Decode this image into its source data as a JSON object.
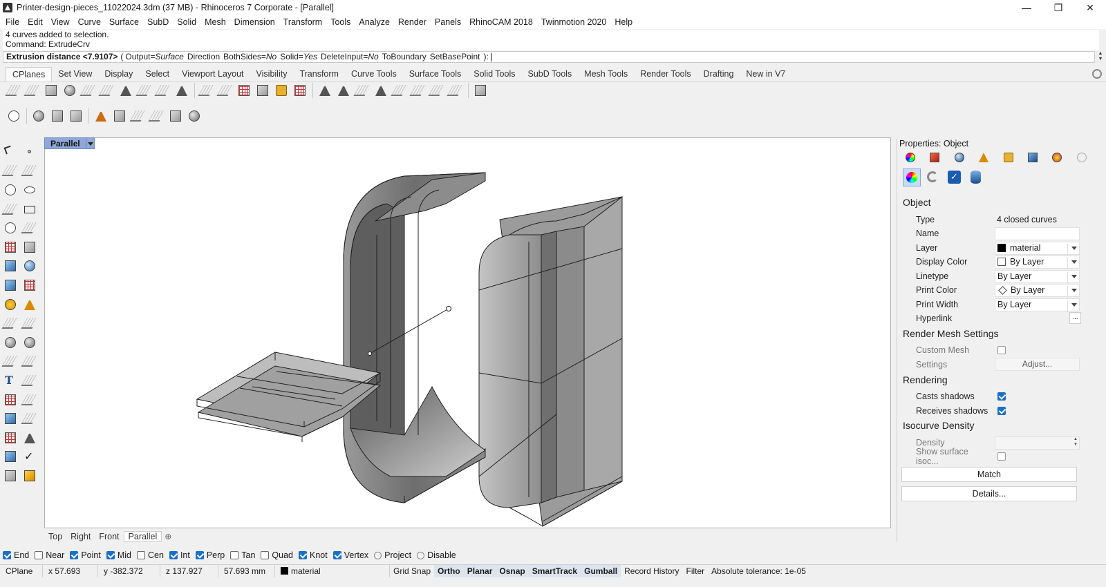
{
  "window": {
    "title": "Printer-design-pieces_11022024.3dm (37 MB) - Rhinoceros 7 Corporate - [Parallel]",
    "minimize": "—",
    "maximize": "❐",
    "close": "✕"
  },
  "menu": [
    "File",
    "Edit",
    "View",
    "Curve",
    "Surface",
    "SubD",
    "Solid",
    "Mesh",
    "Dimension",
    "Transform",
    "Tools",
    "Analyze",
    "Render",
    "Panels",
    "RhinoCAM 2018",
    "Twinmotion 2020",
    "Help"
  ],
  "command": {
    "history": [
      "4 curves added to selection.",
      "Command: ExtrudeCrv"
    ],
    "prompt": "Extrusion distance <7.9107>",
    "open_paren": "(",
    "options": [
      {
        "name": "Output=",
        "value": "Surface"
      },
      {
        "name": "Direction",
        "value": ""
      },
      {
        "name": "BothSides=",
        "value": "No"
      },
      {
        "name": "Solid=",
        "value": "Yes"
      },
      {
        "name": "DeleteInput=",
        "value": "No"
      },
      {
        "name": "ToBoundary",
        "value": ""
      },
      {
        "name": "SetBasePoint",
        "value": ""
      }
    ],
    "close_paren": "):"
  },
  "toolbar_tabs": [
    "CPlanes",
    "Set View",
    "Display",
    "Select",
    "Viewport Layout",
    "Visibility",
    "Transform",
    "Curve Tools",
    "Surface Tools",
    "Solid Tools",
    "SubD Tools",
    "Mesh Tools",
    "Render Tools",
    "Drafting",
    "New in V7"
  ],
  "active_toolbar_tab": "CPlanes",
  "viewport": {
    "title": "Parallel",
    "tabs": [
      "Top",
      "Right",
      "Front",
      "Parallel"
    ],
    "active_tab": "Parallel",
    "add_tab": "⊕"
  },
  "osnaps": [
    {
      "label": "End",
      "checked": true
    },
    {
      "label": "Near",
      "checked": false
    },
    {
      "label": "Point",
      "checked": true
    },
    {
      "label": "Mid",
      "checked": true
    },
    {
      "label": "Cen",
      "checked": false
    },
    {
      "label": "Int",
      "checked": true
    },
    {
      "label": "Perp",
      "checked": true
    },
    {
      "label": "Tan",
      "checked": false
    },
    {
      "label": "Quad",
      "checked": false
    },
    {
      "label": "Knot",
      "checked": true
    },
    {
      "label": "Vertex",
      "checked": true
    }
  ],
  "osnap_project": "Project",
  "osnap_disable": "Disable",
  "status": {
    "cplane": "CPlane",
    "x": "x 57.693",
    "y": "y -382.372",
    "z": "z 137.927",
    "distance": "57.693 mm",
    "layer": "material",
    "toggles": [
      {
        "label": "Grid Snap",
        "on": false
      },
      {
        "label": "Ortho",
        "on": true
      },
      {
        "label": "Planar",
        "on": true
      },
      {
        "label": "Osnap",
        "on": true
      },
      {
        "label": "SmartTrack",
        "on": true
      },
      {
        "label": "Gumball",
        "on": true
      },
      {
        "label": "Record History",
        "on": false
      },
      {
        "label": "Filter",
        "on": false
      }
    ],
    "tolerance": "Absolute tolerance: 1e-05"
  },
  "properties": {
    "title": "Properties: Object",
    "sections": {
      "object": "Object",
      "render_mesh": "Render Mesh Settings",
      "rendering": "Rendering",
      "isocurve": "Isocurve Density"
    },
    "type_label": "Type",
    "type_value": "4 closed curves",
    "name_label": "Name",
    "name_value": "",
    "layer_label": "Layer",
    "layer_value": "material",
    "display_color_label": "Display Color",
    "display_color_value": "By Layer",
    "linetype_label": "Linetype",
    "linetype_value": "By Layer",
    "print_color_label": "Print Color",
    "print_color_value": "By Layer",
    "print_width_label": "Print Width",
    "print_width_value": "By Layer",
    "hyperlink_label": "Hyperlink",
    "hyperlink_button": "...",
    "custom_mesh_label": "Custom Mesh",
    "settings_label": "Settings",
    "adjust_button": "Adjust...",
    "casts_shadows_label": "Casts shadows",
    "casts_shadows": true,
    "receives_shadows_label": "Receives shadows",
    "receives_shadows": true,
    "density_label": "Density",
    "show_iso_label": "Show surface isoc...",
    "match_button": "Match",
    "details_button": "Details..."
  },
  "colors": {
    "viewport_title_bg": "#8fa8d8",
    "check_blue": "#1a6fc9",
    "selection_blue": "#c7dbf3"
  }
}
